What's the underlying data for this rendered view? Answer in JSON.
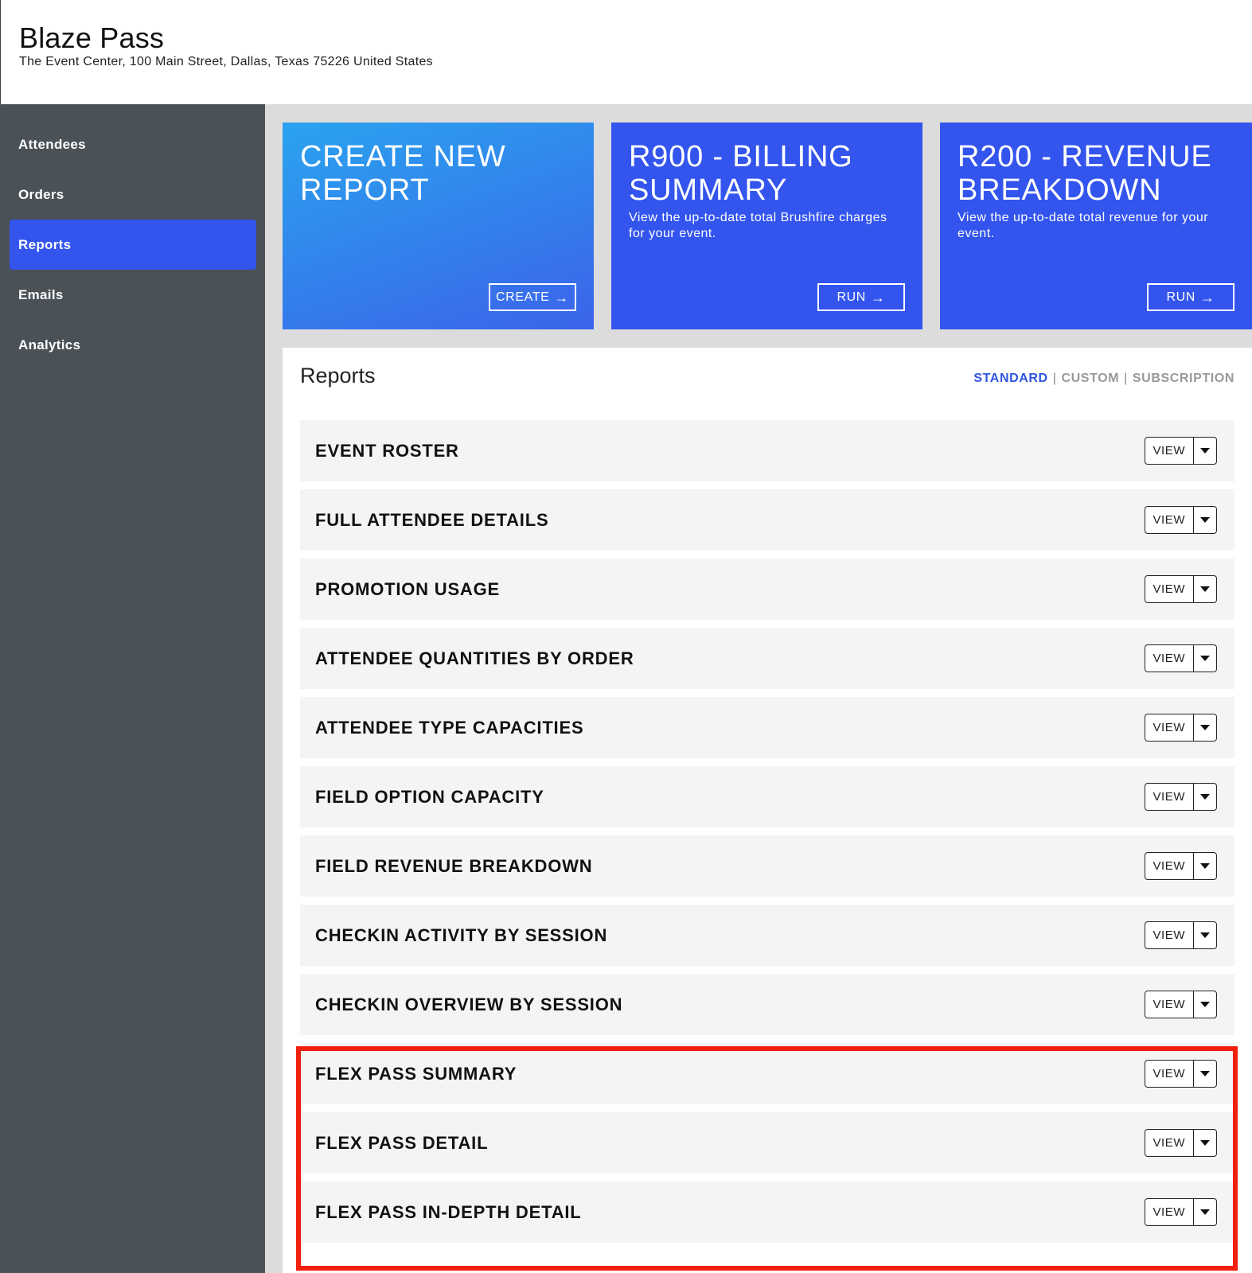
{
  "header": {
    "title": "Blaze Pass",
    "address": "The Event Center, 100 Main Street, Dallas, Texas 75226 United States"
  },
  "sidebar": {
    "items": [
      {
        "label": "Attendees"
      },
      {
        "label": "Orders"
      },
      {
        "label": "Reports",
        "active": true
      },
      {
        "label": "Emails"
      },
      {
        "label": "Analytics"
      }
    ]
  },
  "cards": [
    {
      "title": "CREATE NEW REPORT",
      "description": "",
      "button": "CREATE",
      "button_icon": "arrow-right-icon"
    },
    {
      "title": "R900 - BILLING SUMMARY",
      "description": "View the up-to-date total Brushfire charges for your event.",
      "button": "RUN",
      "button_icon": "arrow-right-icon"
    },
    {
      "title": "R200 - REVENUE BREAKDOWN",
      "description": "View the up-to-date total revenue for your event.",
      "button": "RUN",
      "button_icon": "arrow-right-icon"
    }
  ],
  "reports": {
    "title": "Reports",
    "tabs": [
      {
        "label": "STANDARD",
        "active": true
      },
      {
        "label": "CUSTOM"
      },
      {
        "label": "SUBSCRIPTION"
      }
    ],
    "separator": "|",
    "view_label": "VIEW",
    "rows": [
      {
        "label": "EVENT ROSTER"
      },
      {
        "label": "FULL ATTENDEE DETAILS"
      },
      {
        "label": "PROMOTION USAGE"
      },
      {
        "label": "ATTENDEE QUANTITIES BY ORDER"
      },
      {
        "label": "ATTENDEE TYPE CAPACITIES"
      },
      {
        "label": "FIELD OPTION CAPACITY"
      },
      {
        "label": "FIELD REVENUE BREAKDOWN"
      },
      {
        "label": "CHECKIN ACTIVITY BY SESSION"
      },
      {
        "label": "CHECKIN OVERVIEW BY SESSION"
      },
      {
        "label": "FLEX PASS SUMMARY"
      },
      {
        "label": "FLEX PASS DETAIL"
      },
      {
        "label": "FLEX PASS IN-DEPTH DETAIL"
      }
    ]
  },
  "colors": {
    "accent": "#3355ee",
    "sidebar": "#4a5157",
    "highlight": "#f21f0c"
  }
}
